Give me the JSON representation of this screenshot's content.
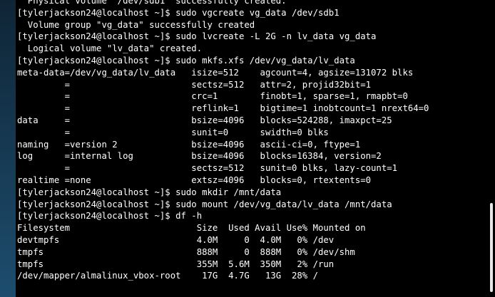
{
  "terminal": {
    "lines": [
      "  Physical volume \"/dev/sdb1\" successfully created.",
      "[tylerjackson24@localhost ~]$ sudo vgcreate vg_data /dev/sdb1",
      "  Volume group \"vg_data\" successfully created",
      "[tylerjackson24@localhost ~]$ sudo lvcreate -L 2G -n lv_data vg_data",
      "  Logical volume \"lv_data\" created.",
      "[tylerjackson24@localhost ~]$ sudo mkfs.xfs /dev/vg_data/lv_data",
      "meta-data=/dev/vg_data/lv_data   isize=512    agcount=4, agsize=131072 blks",
      "         =                       sectsz=512   attr=2, projid32bit=1",
      "         =                       crc=1        finobt=1, sparse=1, rmapbt=0",
      "         =                       reflink=1    bigtime=1 inobtcount=1 nrext64=0",
      "data     =                       bsize=4096   blocks=524288, imaxpct=25",
      "         =                       sunit=0      swidth=0 blks",
      "naming   =version 2              bsize=4096   ascii-ci=0, ftype=1",
      "log      =internal log           bsize=4096   blocks=16384, version=2",
      "         =                       sectsz=512   sunit=0 blks, lazy-count=1",
      "realtime =none                   extsz=4096   blocks=0, rtextents=0",
      "[tylerjackson24@localhost ~]$ sudo mkdir /mnt/data",
      "[tylerjackson24@localhost ~]$ sudo mount /dev/vg_data/lv_data /mnt/data",
      "[tylerjackson24@localhost ~]$ df -h",
      "Filesystem                        Size  Used Avail Use% Mounted on",
      "devtmpfs                          4.0M     0  4.0M   0% /dev",
      "tmpfs                             888M     0  888M   0% /dev/shm",
      "tmpfs                             355M  5.6M  350M   2% /run",
      "/dev/mapper/almalinux_vbox-root    17G  4.7G   13G  28% /"
    ],
    "text_color": "#ffffff",
    "background_color": "#000000"
  }
}
